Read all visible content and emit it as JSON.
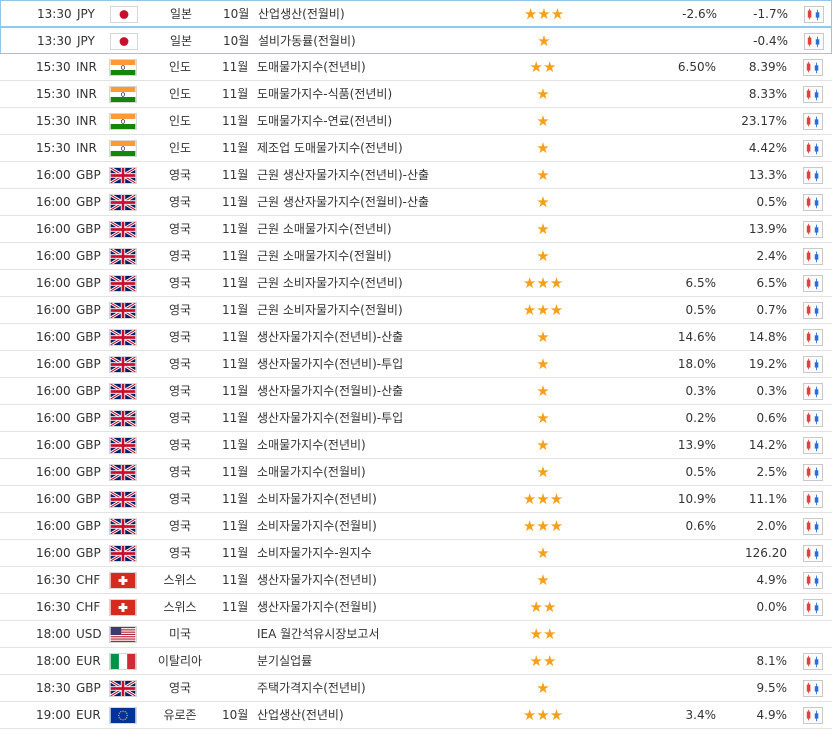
{
  "rows": [
    {
      "time": "13:30",
      "currency": "JPY",
      "flag": "jp",
      "country": "일본",
      "period": "10월",
      "event": "산업생산(전월비)",
      "stars": 3,
      "actual": "-2.6%",
      "previous": "-1.7%",
      "chart": true
    },
    {
      "time": "13:30",
      "currency": "JPY",
      "flag": "jp",
      "country": "일본",
      "period": "10월",
      "event": "설비가동률(전월비)",
      "stars": 1,
      "actual": "",
      "previous": "-0.4%",
      "chart": true
    },
    {
      "time": "15:30",
      "currency": "INR",
      "flag": "in",
      "country": "인도",
      "period": "11월",
      "event": "도매물가지수(전년비)",
      "stars": 2,
      "actual": "6.50%",
      "previous": "8.39%",
      "chart": true
    },
    {
      "time": "15:30",
      "currency": "INR",
      "flag": "in",
      "country": "인도",
      "period": "11월",
      "event": "도매물가지수-식품(전년비)",
      "stars": 1,
      "actual": "",
      "previous": "8.33%",
      "chart": true
    },
    {
      "time": "15:30",
      "currency": "INR",
      "flag": "in",
      "country": "인도",
      "period": "11월",
      "event": "도매물가지수-연료(전년비)",
      "stars": 1,
      "actual": "",
      "previous": "23.17%",
      "chart": true
    },
    {
      "time": "15:30",
      "currency": "INR",
      "flag": "in",
      "country": "인도",
      "period": "11월",
      "event": "제조업 도매물가지수(전년비)",
      "stars": 1,
      "actual": "",
      "previous": "4.42%",
      "chart": true
    },
    {
      "time": "16:00",
      "currency": "GBP",
      "flag": "gb",
      "country": "영국",
      "period": "11월",
      "event": "근원 생산자물가지수(전년비)-산출",
      "stars": 1,
      "actual": "",
      "previous": "13.3%",
      "chart": true
    },
    {
      "time": "16:00",
      "currency": "GBP",
      "flag": "gb",
      "country": "영국",
      "period": "11월",
      "event": "근원 생산자물가지수(전월비)-산출",
      "stars": 1,
      "actual": "",
      "previous": "0.5%",
      "chart": true
    },
    {
      "time": "16:00",
      "currency": "GBP",
      "flag": "gb",
      "country": "영국",
      "period": "11월",
      "event": "근원 소매물가지수(전년비)",
      "stars": 1,
      "actual": "",
      "previous": "13.9%",
      "chart": true
    },
    {
      "time": "16:00",
      "currency": "GBP",
      "flag": "gb",
      "country": "영국",
      "period": "11월",
      "event": "근원 소매물가지수(전월비)",
      "stars": 1,
      "actual": "",
      "previous": "2.4%",
      "chart": true
    },
    {
      "time": "16:00",
      "currency": "GBP",
      "flag": "gb",
      "country": "영국",
      "period": "11월",
      "event": "근원 소비자물가지수(전년비)",
      "stars": 3,
      "actual": "6.5%",
      "previous": "6.5%",
      "chart": true
    },
    {
      "time": "16:00",
      "currency": "GBP",
      "flag": "gb",
      "country": "영국",
      "period": "11월",
      "event": "근원 소비자물가지수(전월비)",
      "stars": 3,
      "actual": "0.5%",
      "previous": "0.7%",
      "chart": true
    },
    {
      "time": "16:00",
      "currency": "GBP",
      "flag": "gb",
      "country": "영국",
      "period": "11월",
      "event": "생산자물가지수(전년비)-산출",
      "stars": 1,
      "actual": "14.6%",
      "previous": "14.8%",
      "chart": true
    },
    {
      "time": "16:00",
      "currency": "GBP",
      "flag": "gb",
      "country": "영국",
      "period": "11월",
      "event": "생산자물가지수(전년비)-투입",
      "stars": 1,
      "actual": "18.0%",
      "previous": "19.2%",
      "chart": true
    },
    {
      "time": "16:00",
      "currency": "GBP",
      "flag": "gb",
      "country": "영국",
      "period": "11월",
      "event": "생산자물가지수(전월비)-산출",
      "stars": 1,
      "actual": "0.3%",
      "previous": "0.3%",
      "chart": true
    },
    {
      "time": "16:00",
      "currency": "GBP",
      "flag": "gb",
      "country": "영국",
      "period": "11월",
      "event": "생산자물가지수(전월비)-투입",
      "stars": 1,
      "actual": "0.2%",
      "previous": "0.6%",
      "chart": true
    },
    {
      "time": "16:00",
      "currency": "GBP",
      "flag": "gb",
      "country": "영국",
      "period": "11월",
      "event": "소매물가지수(전년비)",
      "stars": 1,
      "actual": "13.9%",
      "previous": "14.2%",
      "chart": true
    },
    {
      "time": "16:00",
      "currency": "GBP",
      "flag": "gb",
      "country": "영국",
      "period": "11월",
      "event": "소매물가지수(전월비)",
      "stars": 1,
      "actual": "0.5%",
      "previous": "2.5%",
      "chart": true
    },
    {
      "time": "16:00",
      "currency": "GBP",
      "flag": "gb",
      "country": "영국",
      "period": "11월",
      "event": "소비자물가지수(전년비)",
      "stars": 3,
      "actual": "10.9%",
      "previous": "11.1%",
      "chart": true
    },
    {
      "time": "16:00",
      "currency": "GBP",
      "flag": "gb",
      "country": "영국",
      "period": "11월",
      "event": "소비자물가지수(전월비)",
      "stars": 3,
      "actual": "0.6%",
      "previous": "2.0%",
      "chart": true
    },
    {
      "time": "16:00",
      "currency": "GBP",
      "flag": "gb",
      "country": "영국",
      "period": "11월",
      "event": "소비자물가지수-원지수",
      "stars": 1,
      "actual": "",
      "previous": "126.20",
      "chart": true
    },
    {
      "time": "16:30",
      "currency": "CHF",
      "flag": "ch",
      "country": "스위스",
      "period": "11월",
      "event": "생산자물가지수(전년비)",
      "stars": 1,
      "actual": "",
      "previous": "4.9%",
      "chart": true
    },
    {
      "time": "16:30",
      "currency": "CHF",
      "flag": "ch",
      "country": "스위스",
      "period": "11월",
      "event": "생산자물가지수(전월비)",
      "stars": 2,
      "actual": "",
      "previous": "0.0%",
      "chart": true
    },
    {
      "time": "18:00",
      "currency": "USD",
      "flag": "us",
      "country": "미국",
      "period": "",
      "event": "IEA 월간석유시장보고서",
      "stars": 2,
      "actual": "",
      "previous": "",
      "chart": false
    },
    {
      "time": "18:00",
      "currency": "EUR",
      "flag": "it",
      "country": "이탈리아",
      "period": "",
      "event": "분기실업률",
      "stars": 2,
      "actual": "",
      "previous": "8.1%",
      "chart": true
    },
    {
      "time": "18:30",
      "currency": "GBP",
      "flag": "gb",
      "country": "영국",
      "period": "",
      "event": "주택가격지수(전년비)",
      "stars": 1,
      "actual": "",
      "previous": "9.5%",
      "chart": true
    },
    {
      "time": "19:00",
      "currency": "EUR",
      "flag": "eu",
      "country": "유로존",
      "period": "10월",
      "event": "산업생산(전년비)",
      "stars": 3,
      "actual": "3.4%",
      "previous": "4.9%",
      "chart": true
    }
  ],
  "colors": {
    "star": "#f6a01a",
    "highlight_border": "#8ec8ea",
    "row_border": "#e3e3e3"
  }
}
